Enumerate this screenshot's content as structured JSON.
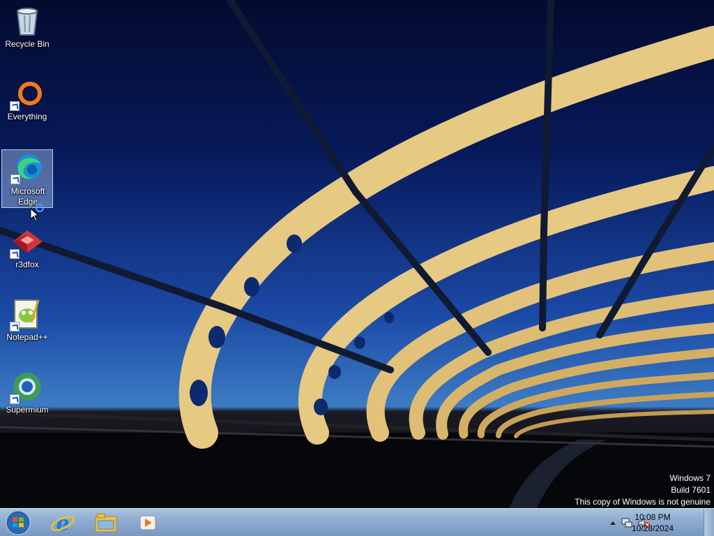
{
  "desktop_icons": [
    {
      "label": "Recycle Bin",
      "icon": "recycle-bin-icon",
      "shortcut": false
    },
    {
      "label": "Everything",
      "icon": "everything-icon",
      "shortcut": true
    },
    {
      "label": "Microsoft Edge",
      "icon": "edge-icon",
      "shortcut": true,
      "selected": true
    },
    {
      "label": "r3dfox",
      "icon": "r3dfox-icon",
      "shortcut": true
    },
    {
      "label": "Notepad++",
      "icon": "notepadpp-icon",
      "shortcut": true
    },
    {
      "label": "Supermium",
      "icon": "supermium-icon",
      "shortcut": true
    }
  ],
  "watermark": {
    "line1": "Windows 7",
    "line2": "Build 7601",
    "line3": "This copy of Windows is not genuine"
  },
  "taskbar": {
    "pinned": [
      "internet-explorer-icon",
      "file-explorer-icon",
      "media-player-icon"
    ],
    "clock_time": "10:08 PM",
    "clock_date": "10/28/2024"
  }
}
